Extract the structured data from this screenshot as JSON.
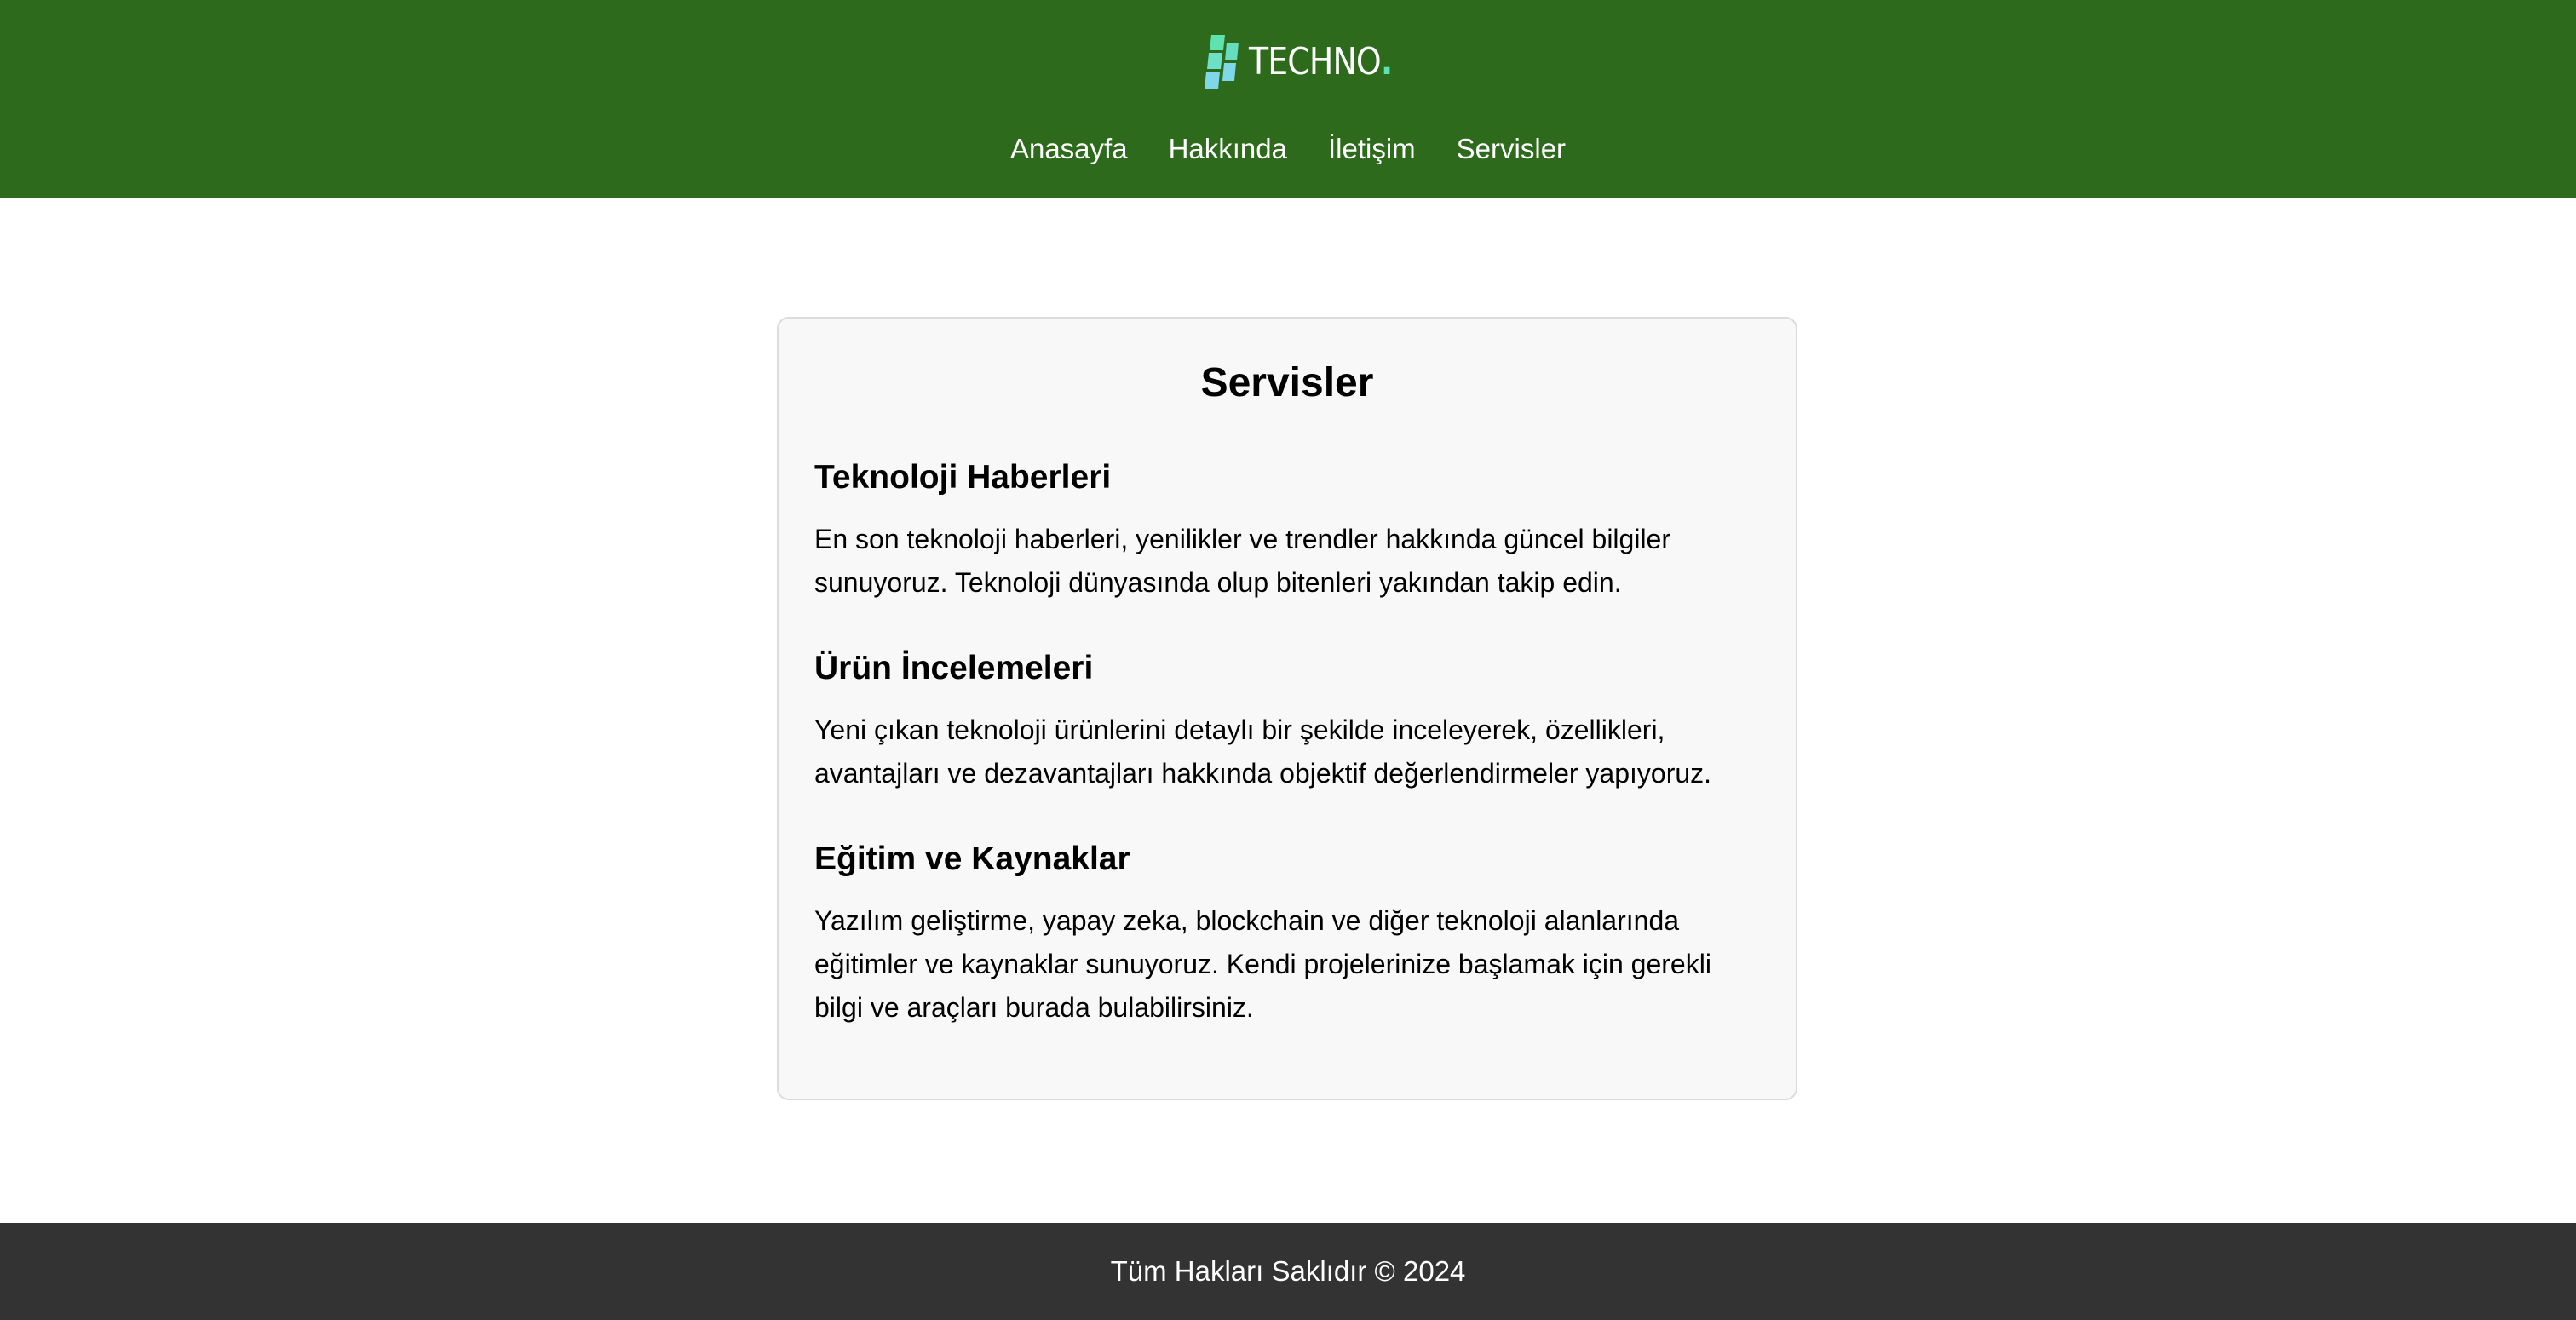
{
  "header": {
    "logo_text": "TECHNO",
    "logo_dot": ".",
    "logo_icon": "techno-logo-icon",
    "background_color": "#2d6a1c",
    "accent_color": "#5ee3b0"
  },
  "nav": {
    "items": [
      {
        "label": "Anasayfa"
      },
      {
        "label": "Hakkında"
      },
      {
        "label": "İletişim"
      },
      {
        "label": "Servisler"
      }
    ]
  },
  "main": {
    "title": "Servisler",
    "sections": [
      {
        "heading": "Teknoloji Haberleri",
        "text": "En son teknoloji haberleri, yenilikler ve trendler hakkında güncel bilgiler sunuyoruz. Teknoloji dünyasında olup bitenleri yakından takip edin."
      },
      {
        "heading": "Ürün İncelemeleri",
        "text": "Yeni çıkan teknoloji ürünlerini detaylı bir şekilde inceleyerek, özellikleri, avantajları ve dezavantajları hakkında objektif değerlendirmeler yapıyoruz."
      },
      {
        "heading": "Eğitim ve Kaynaklar",
        "text": "Yazılım geliştirme, yapay zeka, blockchain ve diğer teknoloji alanlarında eğitimler ve kaynaklar sunuyoruz. Kendi projelerinize başlamak için gerekli bilgi ve araçları burada bulabilirsiniz."
      }
    ]
  },
  "footer": {
    "text": "Tüm Hakları Saklıdır © 2024",
    "background_color": "#333333"
  }
}
